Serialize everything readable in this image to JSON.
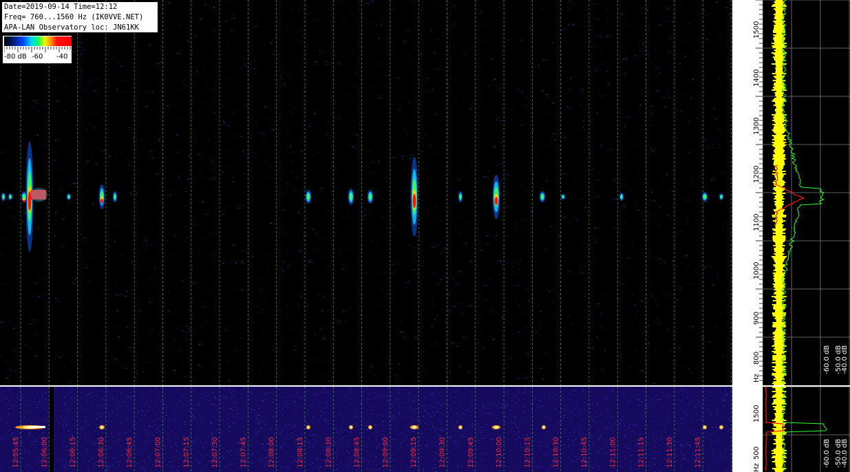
{
  "info": {
    "line1": "Date=2019-09-14 Time=12:12",
    "line2": "Freq= 760...1560 Hz (IK0VVE.NET)",
    "line3": "APA-LAN Observatory loc: JN61KK"
  },
  "scale": {
    "labels": [
      "-80 dB",
      "-60",
      "-40"
    ]
  },
  "freq_axis": {
    "ticks": [
      "1500",
      "1400",
      "1300",
      "1200",
      "1100",
      "1000",
      "900",
      "800"
    ],
    "unit": "Hz"
  },
  "spectrum_axis": {
    "labels": [
      "-60.0 dB",
      "-50.0 dB",
      "-40.0 dB"
    ]
  },
  "low_freq_axis": {
    "ticks": [
      "1500",
      "500"
    ],
    "unit": "Hz"
  },
  "time_labels": [
    "12:05:45",
    "12:06:00",
    "12:06:15",
    "12:06:30",
    "12:06:45",
    "12:07:00",
    "12:07:15",
    "12:07:30",
    "12:07:45",
    "12:08:00",
    "12:08:15",
    "12:08:30",
    "12:08:45",
    "12:09:00",
    "12:09:15",
    "12:09:30",
    "12:09:45",
    "12:10:00",
    "12:10:15",
    "12:10:30",
    "12:10:45",
    "12:11:00",
    "12:11:15",
    "12:11:30",
    "12:11:45"
  ],
  "colors": {
    "time_label": "#ff2030",
    "grid": "#2f9a2f",
    "info_bg": "#ffffff",
    "low_bg": "#160a5e"
  }
}
